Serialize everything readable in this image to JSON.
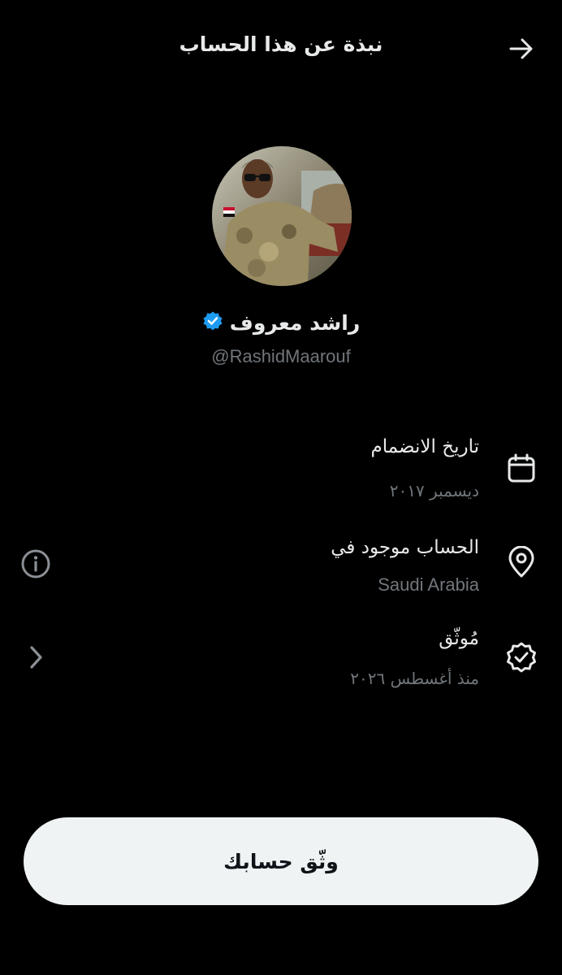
{
  "header": {
    "title": "نبذة عن هذا الحساب",
    "back_icon": "arrow-right-icon"
  },
  "profile": {
    "name": "راشد معروف",
    "handle": "@RashidMaarouf",
    "verified_badge_icon": "verified-badge-icon",
    "verified_color": "#1d9bf0"
  },
  "info": {
    "joined": {
      "title": "تاريخ الانضمام",
      "value": "ديسمبر ٢٠١٧",
      "icon": "calendar-icon"
    },
    "location": {
      "title": "الحساب موجود في",
      "value": "Saudi Arabia",
      "icon": "location-pin-icon",
      "side_icon": "info-icon"
    },
    "verified": {
      "title": "مُوثّق",
      "value": "منذ أغسطس ٢٠٢٦",
      "icon": "verified-check-icon",
      "side_icon": "chevron-right-icon"
    }
  },
  "footer": {
    "verify_button_label": "وثّق حسابك"
  },
  "colors": {
    "background": "#000000",
    "primary_text": "#e7e9ea",
    "secondary_text": "#71767b",
    "button_bg": "#eff3f4",
    "button_text": "#0f1419"
  }
}
